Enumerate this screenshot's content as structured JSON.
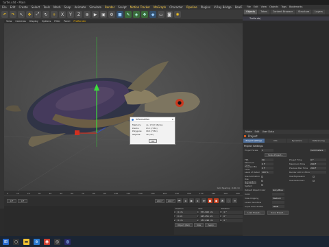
{
  "window": {
    "title": "turtle.c4d - Main"
  },
  "menubar": {
    "items": [
      "File",
      "Edit",
      "Create",
      "Select",
      "Tools",
      "Mesh",
      "Snap",
      "Animate",
      "Simulate",
      "Render",
      "Sculpt",
      "Motion Tracker",
      "MoGraph",
      "Character",
      "Pipeline",
      "Plugins",
      "V-Ray Bridge",
      "RealFlow",
      "Script",
      "Window",
      "Help"
    ],
    "highlighted": [
      "Render",
      "Motion Tracker",
      "MoGraph",
      "Pipeline",
      "Window",
      "Help"
    ]
  },
  "vpmenu": {
    "items": [
      "View",
      "Cameras",
      "Display",
      "Options",
      "Filter",
      "Panel",
      "ProRender"
    ]
  },
  "viewport": {
    "grid_spacing": "Grid Spacing : 100 cm"
  },
  "info_dialog": {
    "title": "Information",
    "close": "x",
    "rows": [
      {
        "k": "Memory:",
        "v": "ca. 1702 KBytes"
      },
      {
        "k": "Points:",
        "v": "653 (7384)"
      },
      {
        "k": "Polygons:",
        "v": "968 (7384)"
      },
      {
        "k": "Objects:",
        "v": "36 (42)"
      }
    ],
    "ok": "OK"
  },
  "timeline": {
    "ticks": [
      "0",
      "10",
      "20",
      "30",
      "40",
      "50",
      "60",
      "70",
      "80",
      "90",
      "100",
      "110",
      "120",
      "130",
      "140",
      "150",
      "160",
      "170",
      "180",
      "190",
      "200"
    ],
    "start": "0 F",
    "current": "0 F",
    "end": "200 F",
    "end2": "200 F"
  },
  "coords": {
    "headers": [
      "Position",
      "Size",
      "Rotation"
    ],
    "rows": [
      [
        "X",
        "0 cm",
        "X",
        "571.962 cm",
        "H",
        "0 °"
      ],
      [
        "Y",
        "0 cm",
        "Y",
        "125.451 cm",
        "P",
        "0 °"
      ],
      [
        "Z",
        "0 cm",
        "Z",
        "157.496 cm",
        "B",
        "0 °"
      ]
    ],
    "mode1": "Object (Rel)",
    "mode2": "Size",
    "apply": "Apply"
  },
  "right_panel": {
    "menu": [
      "File",
      "Edit",
      "View",
      "Objects",
      "Tags",
      "Bookmarks"
    ],
    "tabs": [
      "Objects",
      "Takes",
      "Content Browser",
      "Structure",
      "Layers"
    ],
    "object": "Turtle.obj"
  },
  "attributes": {
    "menu": [
      "Mode",
      "Edit",
      "User Data"
    ],
    "title": "Project",
    "tabs": [
      "Project Settings",
      "Info",
      "Dynamics",
      "Referencing"
    ],
    "section": "Project Settings",
    "rows": [
      {
        "k": "Project Scale",
        "v": "1",
        "k2": "",
        "v2": "Centimeters"
      },
      {
        "k": "FPS",
        "v": "30",
        "k2": "Project Time",
        "v2": "0 F"
      },
      {
        "k": "Minimum Time",
        "v": "0 F",
        "k2": "Maximum Time",
        "v2": "200 F"
      },
      {
        "k": "Preview Min Time",
        "v": "0 F",
        "k2": "Preview Max Time",
        "v2": "200 F"
      },
      {
        "k": "Level of Detail",
        "v": "100 %",
        "k2": "Render LOD in Editor",
        "v2": ""
      }
    ],
    "scale_button": "Scale Project...",
    "checks": [
      {
        "k": "Use Animation",
        "k2": "Use Expression"
      },
      {
        "k": "Use Generators",
        "k2": "Use Deformers"
      },
      {
        "k": "Use Motion System",
        "k2": ""
      }
    ],
    "rows2": [
      {
        "k": "Default Object Color",
        "v": "Gray-Blue"
      },
      {
        "k": "Color",
        "v": ""
      },
      {
        "k": "View Clipping",
        "v": "Medium"
      },
      {
        "k": "Linear Workflow",
        "v": ""
      },
      {
        "k": "Input Color Profile",
        "v": "sRGB"
      }
    ],
    "buttons": [
      "Load Preset...",
      "Save Preset..."
    ]
  },
  "colors": {
    "accent": "#f5b400",
    "panel": "#2f2f2f"
  }
}
